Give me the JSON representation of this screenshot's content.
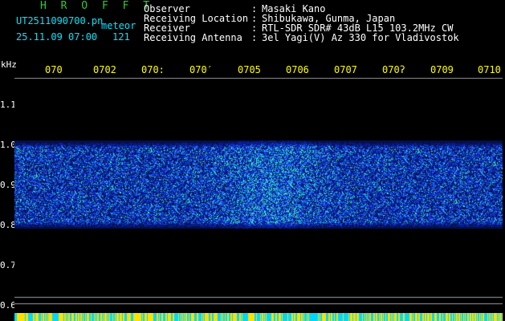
{
  "header": {
    "logo": "H R O F F T",
    "file_name": "UT2511090700.pn",
    "file_suffix": "meteor",
    "date_time": "25.11.09 07:00",
    "count": "121"
  },
  "info": [
    {
      "label": "Observer",
      "value": "Masaki Kano"
    },
    {
      "label": "Receiving Location",
      "value": "Shibukawa, Gunma, Japan"
    },
    {
      "label": "Receiver",
      "value": "RTL-SDR SDR# 43dB L15 103.2MHz CW"
    },
    {
      "label": "Receiving Antenna",
      "value": "3el Yagi(V) Az 330 for Vladivostok"
    }
  ],
  "separator": ":",
  "axis": {
    "unit": "kHz",
    "x_ticks": [
      "070",
      "0702",
      "070:",
      "070′",
      "0705",
      "0706",
      "0707",
      "070ʔ",
      "0709",
      "0710"
    ],
    "y_ticks": [
      "1.1",
      "1.0",
      "0.9",
      "0.8",
      "0.7",
      "0.6"
    ]
  },
  "colors": {
    "background": "#000000",
    "logo": "#2ecc2e",
    "file_text": "#00e5ff",
    "tick_text": "#ffff00",
    "info_text": "#ffffff",
    "signal_low": "#0a1f9e",
    "signal_mid": "#1e5cff",
    "signal_high": "#38e8c8",
    "noise_floor_line": "#9aa0aa",
    "strip_yellow": "#ffe000",
    "strip_cyan": "#00d8ff"
  },
  "spectrogram": {
    "band_khz": [
      0.79,
      1.01
    ],
    "freq_range_khz": [
      0.58,
      1.18
    ]
  }
}
